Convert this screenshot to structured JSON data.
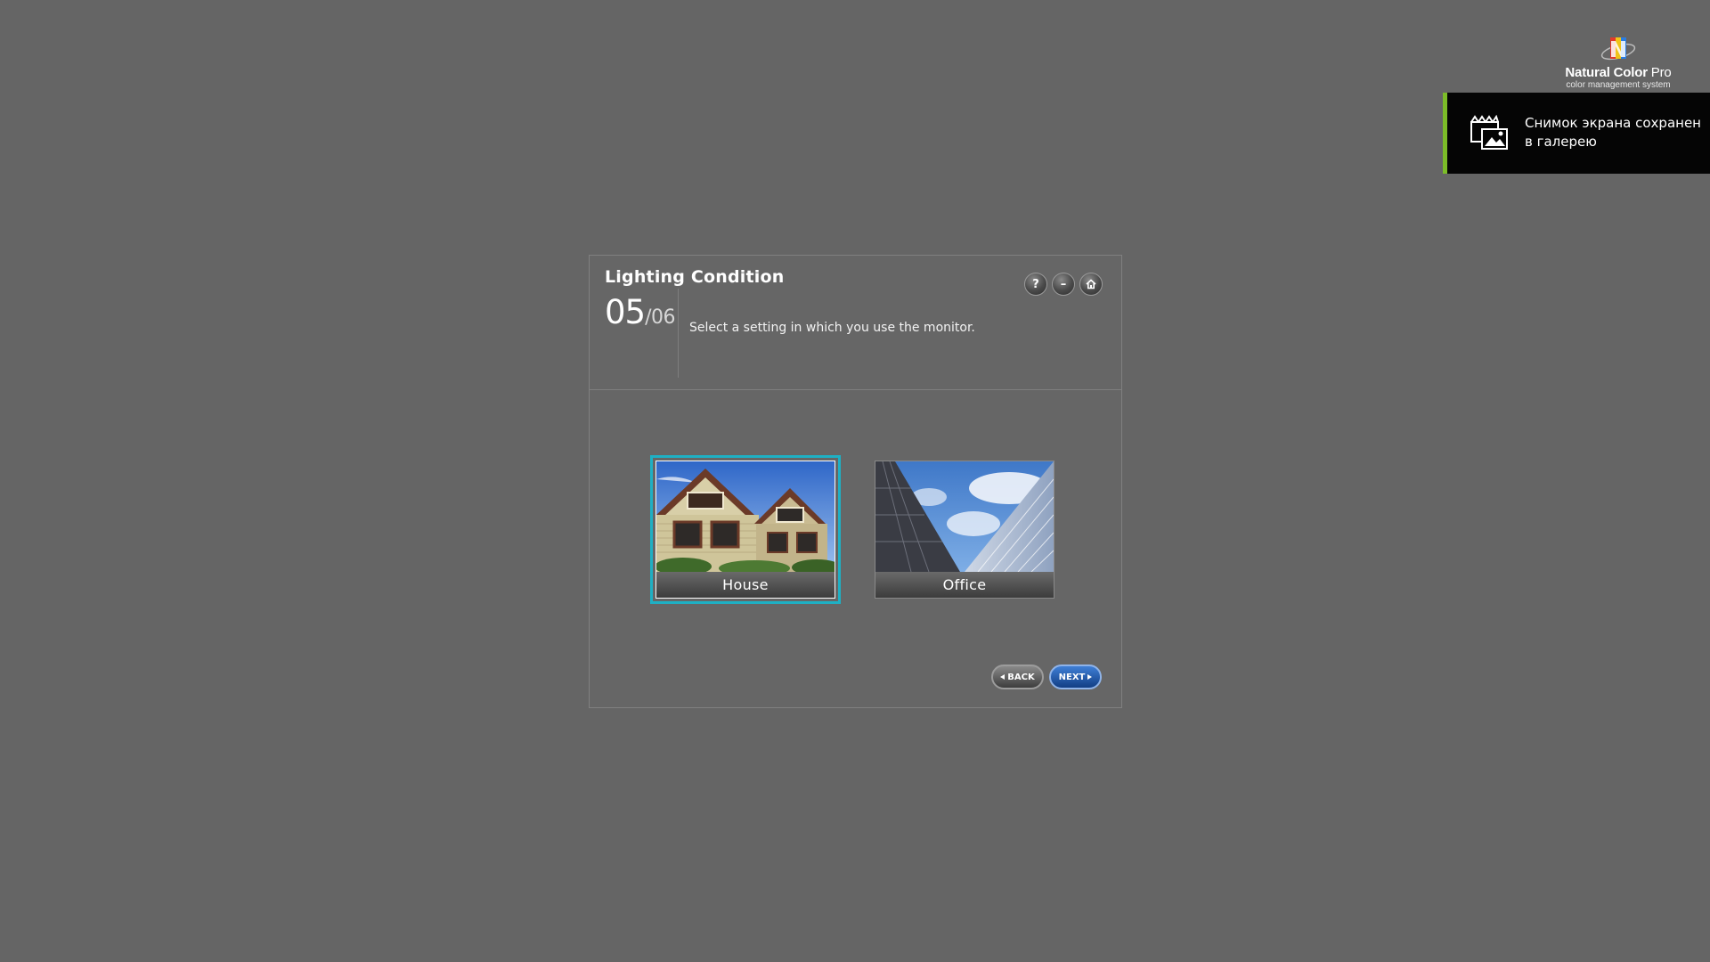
{
  "brand": {
    "name_bold": "Natural Color",
    "name_light": " Pro",
    "subtitle": "color management system"
  },
  "toast": {
    "line1": "Снимок экрана сохранен",
    "line2": "в галерею",
    "icon": "screenshot-gallery-icon",
    "accent_color": "#7cbd28"
  },
  "dialog": {
    "title": "Lighting Condition",
    "step_current": "05",
    "step_total": "/06",
    "instruction": "Select a setting in which you use the monitor.",
    "buttons": {
      "help": "?",
      "minimize": "–",
      "home_icon": "home-icon"
    },
    "options": [
      {
        "label": "House",
        "selected": true,
        "image": "house-photo"
      },
      {
        "label": "Office",
        "selected": false,
        "image": "office-buildings-photo"
      }
    ],
    "selection_color": "#1eb0c4",
    "nav": {
      "back": "BACK",
      "next": "NEXT"
    }
  },
  "colors": {
    "background": "#656565",
    "toast_background": "#050505",
    "next_button": "#1f5bb0"
  }
}
